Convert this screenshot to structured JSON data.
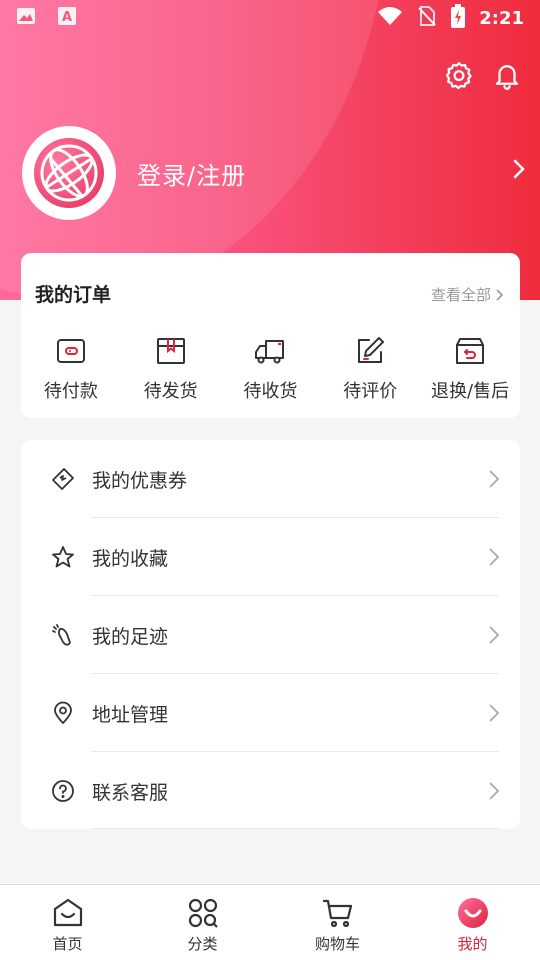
{
  "status_bar": {
    "time": "2:21",
    "left_icons": [
      "image-icon",
      "app-a-icon"
    ],
    "right_icons": [
      "wifi-icon",
      "no-sim-icon",
      "battery-charging-icon"
    ]
  },
  "header": {
    "icons": [
      "settings-icon",
      "bell-icon"
    ],
    "login_label": "登录/注册"
  },
  "orders": {
    "title": "我的订单",
    "view_all": "查看全部",
    "items": [
      {
        "label": "待付款",
        "icon": "wallet-icon"
      },
      {
        "label": "待发货",
        "icon": "package-icon"
      },
      {
        "label": "待收货",
        "icon": "truck-icon"
      },
      {
        "label": "待评价",
        "icon": "edit-icon"
      },
      {
        "label": "退换/售后",
        "icon": "return-box-icon"
      }
    ]
  },
  "menu": {
    "items": [
      {
        "label": "我的优惠券",
        "icon": "coupon-icon"
      },
      {
        "label": "我的收藏",
        "icon": "star-icon"
      },
      {
        "label": "我的足迹",
        "icon": "footprint-icon"
      },
      {
        "label": "地址管理",
        "icon": "location-icon"
      },
      {
        "label": "联系客服",
        "icon": "help-icon"
      }
    ]
  },
  "tab_bar": {
    "tabs": [
      {
        "label": "首页",
        "icon": "home-icon",
        "active": false
      },
      {
        "label": "分类",
        "icon": "category-icon",
        "active": false
      },
      {
        "label": "购物车",
        "icon": "cart-icon",
        "active": false
      },
      {
        "label": "我的",
        "icon": "profile-icon",
        "active": true
      }
    ]
  },
  "colors": {
    "accent": "#e0223a",
    "gradient_start": "#ff6a9a",
    "gradient_end": "#ef2c3c"
  }
}
